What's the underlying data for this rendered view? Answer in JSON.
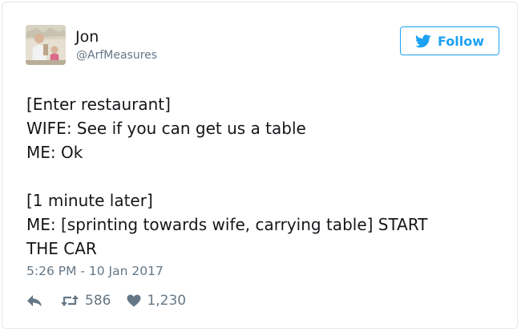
{
  "user": {
    "name": "Jon",
    "handle": "@ArfMeasures"
  },
  "follow_button": {
    "label": "Follow",
    "icon": "twitter-bird-icon"
  },
  "tweet": {
    "lines": [
      "[Enter restaurant]",
      "WIFE: See if you can get us a table",
      "ME: Ok",
      "",
      "[1 minute later]",
      "ME: [sprinting towards wife, carrying table] START",
      "THE CAR"
    ]
  },
  "timestamp": "5:26 PM - 10 Jan 2017",
  "actions": {
    "reply_icon": "reply-icon",
    "retweet_icon": "retweet-icon",
    "retweet_count": "586",
    "like_icon": "heart-icon",
    "like_count": "1,230"
  },
  "colors": {
    "accent": "#1da1f2",
    "text": "#14171a",
    "secondary_text": "#657786",
    "border": "#e1e8ed"
  }
}
